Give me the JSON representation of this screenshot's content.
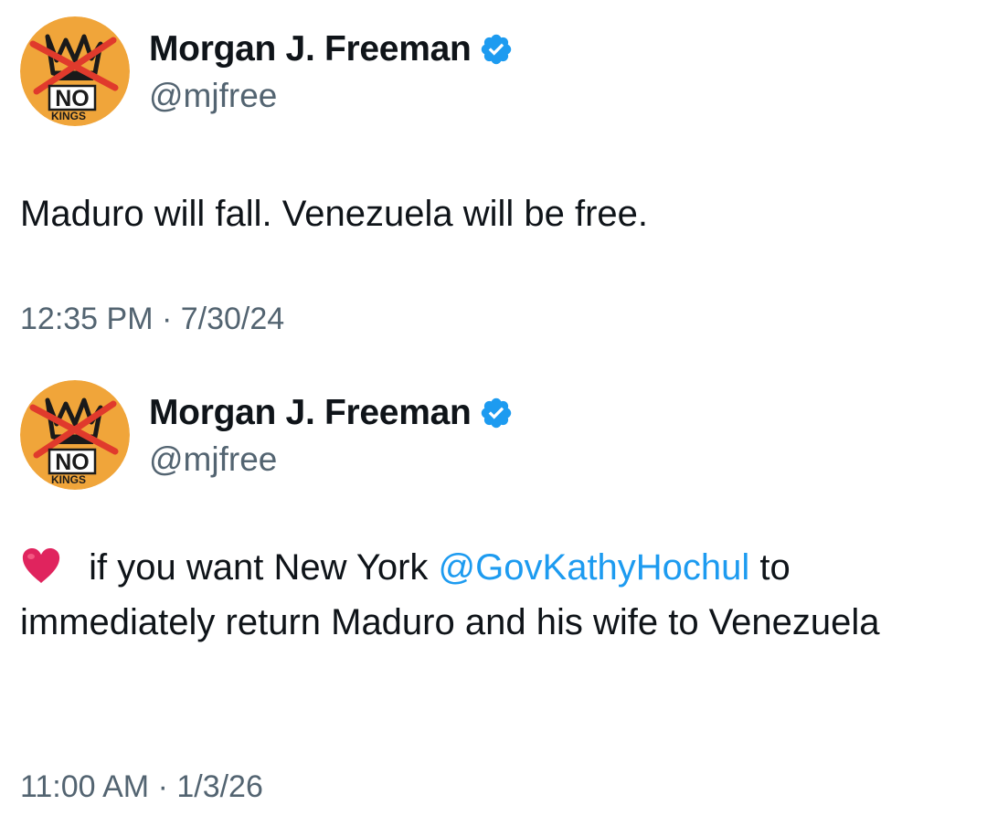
{
  "tweets": [
    {
      "author": {
        "display_name": "Morgan J. Freeman",
        "handle": "@mjfree",
        "verified": true,
        "avatar": {
          "icon": "no-kings-crown-logo",
          "logo_text_primary": "NO",
          "logo_text_secondary": "KINGS",
          "background_color": "#f0a53a"
        }
      },
      "text": "Maduro will fall. Venezuela will be free.",
      "timestamp": "12:35 PM · 7/30/24"
    },
    {
      "author": {
        "display_name": "Morgan J. Freeman",
        "handle": "@mjfree",
        "verified": true,
        "avatar": {
          "icon": "no-kings-crown-logo",
          "logo_text_primary": "NO",
          "logo_text_secondary": "KINGS",
          "background_color": "#f0a53a"
        }
      },
      "text_parts": {
        "emoji": "red-heart-emoji",
        "before_mention": " if you want New York ",
        "mention": "@GovKathyHochul",
        "after_mention": " to immediately return Maduro and his wife to Venezuela"
      },
      "timestamp": "11:00 AM · 1/3/26"
    }
  ],
  "colors": {
    "link": "#1d9bf0",
    "secondary_text": "#536471",
    "verified_badge": "#1d9bf0",
    "heart": "#e0245e"
  }
}
